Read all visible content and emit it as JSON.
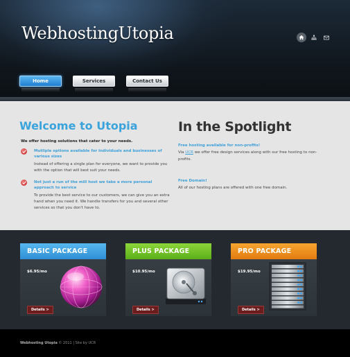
{
  "site": {
    "logo": "WebhostingUtopia"
  },
  "header_icons": [
    {
      "icon": "home-icon"
    },
    {
      "icon": "sitemap-icon"
    },
    {
      "icon": "mail-icon"
    }
  ],
  "nav": {
    "items": [
      {
        "label": "Home",
        "active": true
      },
      {
        "label": "Services",
        "active": false
      },
      {
        "label": "Contact Us",
        "active": false
      }
    ]
  },
  "welcome": {
    "title": "Welcome to Utopia",
    "intro": "We offer hosting solutions that cater to your needs.",
    "features": [
      {
        "title": "Mutliple options available for individuals and businesses of various sizes",
        "text": "Instead of offering a single plan for everyone, we want to provide you with the option that will best suit your needs."
      },
      {
        "title": "Not just a run of the mill host we take a more personal approach to service",
        "text": "To provide the best service to our customers, we can give you an extra hand when you need it. We handle transfers for you and several other services so that you don't have to."
      }
    ]
  },
  "spotlight": {
    "title": "In the Spotlight",
    "items": [
      {
        "title": "Free hosting available for non-profits!",
        "text_before": "Via ",
        "link": "UCR",
        "text_after": " we offer free design services along with our free hosting to non-profits."
      },
      {
        "title": "Free Domain!",
        "text": "All of our hosting plans are offered with one free domain."
      }
    ]
  },
  "packages": [
    {
      "name": "BASIC PACKAGE",
      "price": "$6.95/mo",
      "button": "Details >",
      "color": "#3ea3e3",
      "image": "globe-icon"
    },
    {
      "name": "PLUS PACKAGE",
      "price": "$10.95/mo",
      "button": "Details >",
      "color": "#76c42b",
      "image": "hard-drive-icon"
    },
    {
      "name": "PRO PACKAGE",
      "price": "$19.95/mo",
      "button": "Details >",
      "color": "#ee8f1f",
      "image": "server-rack-icon"
    }
  ],
  "footer": {
    "brand": "Webhosting Utopia",
    "text": " © 2011 | Site by UCR"
  }
}
